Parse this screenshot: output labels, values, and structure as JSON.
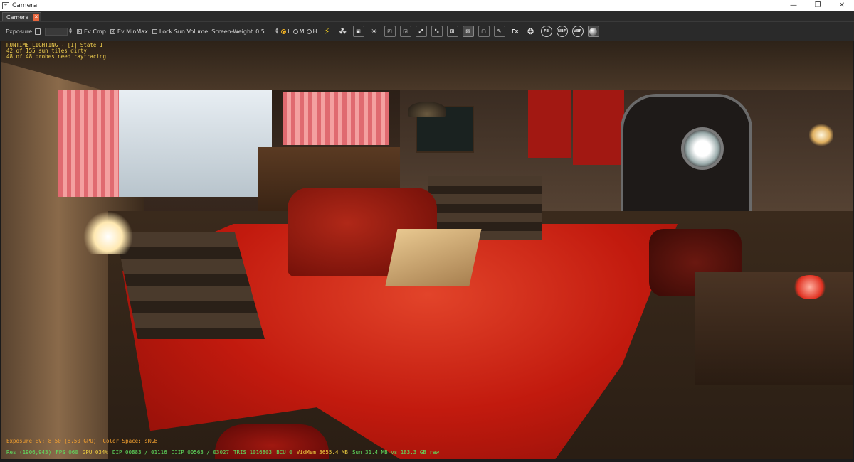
{
  "window": {
    "title": "Camera",
    "minimize": "—",
    "maximize": "❐",
    "close": "✕"
  },
  "tabs": [
    {
      "label": "Camera",
      "close": "✕"
    }
  ],
  "toolbar": {
    "exposure_label": "Exposure",
    "ev_cmp_label": "Ev Cmp",
    "ev_minmax_label": "Ev MinMax",
    "lock_sun_volume_label": "Lock Sun Volume",
    "screen_weight_label": "Screen-Weight",
    "screen_weight_value": "0.5",
    "quality_options": [
      "L",
      "M",
      "H"
    ],
    "quality_selected": "L",
    "icon_labels": {
      "fx": "Fx",
      "fb": "FB",
      "nbf": "NBF",
      "vbf": "VBF"
    }
  },
  "hud": {
    "line1": "RUNTIME LIGHTING - [1] State 1",
    "line2": "42 of 155 sun tiles dirty",
    "line3": "48 of 48 probes need raytracing",
    "exposure": "Exposure EV: 8.50 (8.50 GPU)  Color Space: sRGB"
  },
  "status": {
    "res": "Res (1906,943)",
    "fps": "FPS 060",
    "gpu": "GPU 034%",
    "dip": "DIP 00883 / 01116",
    "dip2": "DIIP 00563 / 03027",
    "tris": "TRIS 1016803",
    "bcu": "BCU 0",
    "vidmem": "VidMem 3655.4 MB",
    "sun": "Sun 31.4 MB vs 183.3 GB raw"
  },
  "colors": {
    "hud_yellow": "#f2d050",
    "hud_orange": "#f2a030",
    "status_green": "#60e060",
    "tab_close": "#e8663d",
    "carpet_red": "#c21a0e"
  }
}
